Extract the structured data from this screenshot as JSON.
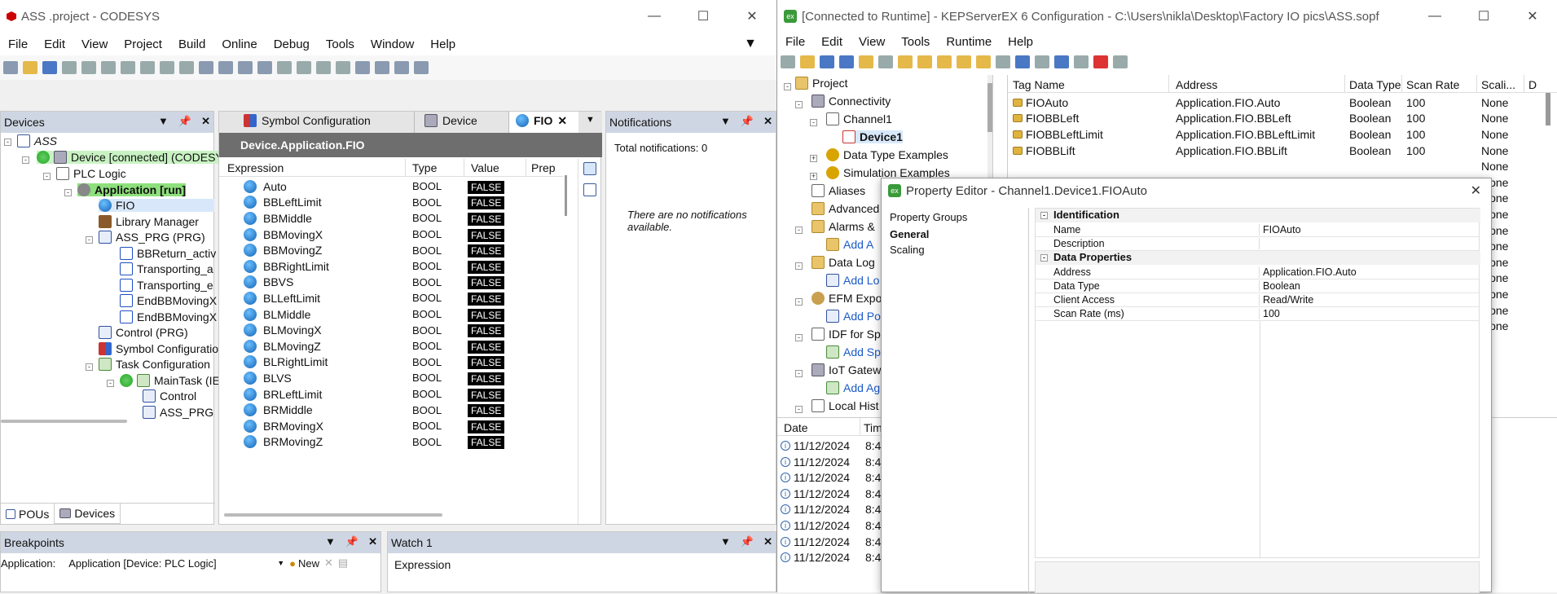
{
  "codesys": {
    "title": "ASS .project - CODESYS",
    "menu": [
      "File",
      "Edit",
      "View",
      "Project",
      "Build",
      "Online",
      "Debug",
      "Tools",
      "Window",
      "Help"
    ],
    "devices_panel": {
      "title": "Devices",
      "tree": [
        "ASS",
        "Device [connected] (CODESYS",
        "PLC Logic",
        "Application [run]",
        "FIO",
        "Library Manager",
        "ASS_PRG (PRG)",
        "BBReturn_activ",
        "Transporting_a",
        "Transporting_e",
        "EndBBMovingX",
        "EndBBMovingX",
        "Control (PRG)",
        "Symbol Configuratio",
        "Task Configuration",
        "MainTask (IE",
        "Control",
        "ASS_PRG"
      ]
    },
    "tabs": {
      "pous": "POUs",
      "devices": "Devices"
    },
    "editor_tabs": [
      "Symbol Configuration",
      "Device",
      "FIO"
    ],
    "watch_title": "Device.Application.FIO",
    "columns": {
      "expression": "Expression",
      "type": "Type",
      "value": "Value",
      "prep": "Prep"
    },
    "rows": [
      {
        "e": "Auto",
        "t": "BOOL",
        "v": "FALSE"
      },
      {
        "e": "BBLeftLimit",
        "t": "BOOL",
        "v": "FALSE"
      },
      {
        "e": "BBMiddle",
        "t": "BOOL",
        "v": "FALSE"
      },
      {
        "e": "BBMovingX",
        "t": "BOOL",
        "v": "FALSE"
      },
      {
        "e": "BBMovingZ",
        "t": "BOOL",
        "v": "FALSE"
      },
      {
        "e": "BBRightLimit",
        "t": "BOOL",
        "v": "FALSE"
      },
      {
        "e": "BBVS",
        "t": "BOOL",
        "v": "FALSE"
      },
      {
        "e": "BLLeftLimit",
        "t": "BOOL",
        "v": "FALSE"
      },
      {
        "e": "BLMiddle",
        "t": "BOOL",
        "v": "FALSE"
      },
      {
        "e": "BLMovingX",
        "t": "BOOL",
        "v": "FALSE"
      },
      {
        "e": "BLMovingZ",
        "t": "BOOL",
        "v": "FALSE"
      },
      {
        "e": "BLRightLimit",
        "t": "BOOL",
        "v": "FALSE"
      },
      {
        "e": "BLVS",
        "t": "BOOL",
        "v": "FALSE"
      },
      {
        "e": "BRLeftLimit",
        "t": "BOOL",
        "v": "FALSE"
      },
      {
        "e": "BRMiddle",
        "t": "BOOL",
        "v": "FALSE"
      },
      {
        "e": "BRMovingX",
        "t": "BOOL",
        "v": "FALSE"
      },
      {
        "e": "BRMovingZ",
        "t": "BOOL",
        "v": "FALSE"
      }
    ],
    "notifications": {
      "title": "Notifications",
      "total": "Total notifications: 0",
      "empty": "There are no notifications available."
    },
    "breakpoints": {
      "title": "Breakpoints",
      "app_label": "Application:",
      "app_value": "Application [Device: PLC Logic]",
      "new": "New"
    },
    "watch1": {
      "title": "Watch 1",
      "col": "Expression"
    }
  },
  "kep": {
    "title": "[Connected to Runtime] - KEPServerEX 6 Configuration - C:\\Users\\nikla\\Desktop\\Factory IO pics\\ASS.sopf",
    "menu": [
      "File",
      "Edit",
      "View",
      "Tools",
      "Runtime",
      "Help"
    ],
    "tree": [
      "Project",
      "Connectivity",
      "Channel1",
      "Device1",
      "Data Type Examples",
      "Simulation Examples",
      "Aliases",
      "Advanced",
      "Alarms &",
      "Add A",
      "Data Log",
      "Add Lo",
      "EFM Expo",
      "Add Po",
      "IDF for Sp",
      "Add Sp",
      "IoT Gatew",
      "Add Ag",
      "Local Hist"
    ],
    "columns": {
      "tag": "Tag Name",
      "address": "Address",
      "type": "Data Type",
      "scan": "Scan Rate",
      "scaling": "Scali...",
      "d": "D"
    },
    "tags": [
      {
        "n": "FIOAuto",
        "a": "Application.FIO.Auto",
        "t": "Boolean",
        "s": "100",
        "sc": "None"
      },
      {
        "n": "FIOBBLeft",
        "a": "Application.FIO.BBLeft",
        "t": "Boolean",
        "s": "100",
        "sc": "None"
      },
      {
        "n": "FIOBBLeftLimit",
        "a": "Application.FIO.BBLeftLimit",
        "t": "Boolean",
        "s": "100",
        "sc": "None"
      },
      {
        "n": "FIOBBLift",
        "a": "Application.FIO.BBLift",
        "t": "Boolean",
        "s": "100",
        "sc": "None"
      }
    ],
    "extra_scaling": [
      "None",
      "None",
      "None",
      "None",
      "None",
      "None",
      "None",
      "None",
      "None",
      "None",
      "None"
    ],
    "log": {
      "date": "Date",
      "time": "Tim",
      "rows": [
        "11/12/2024",
        "11/12/2024",
        "11/12/2024",
        "11/12/2024",
        "11/12/2024",
        "11/12/2024",
        "11/12/2024",
        "11/12/2024"
      ],
      "time_val": "8:4"
    },
    "prop": {
      "title": "Property Editor - Channel1.Device1.FIOAuto",
      "groups_title": "Property Groups",
      "groups": [
        "General",
        "Scaling"
      ],
      "sections": {
        "identification": "Identification",
        "data_props": "Data Properties"
      },
      "fields": [
        {
          "k": "Name",
          "v": "FIOAuto"
        },
        {
          "k": "Description",
          "v": ""
        },
        {
          "k": "Address",
          "v": "Application.FIO.Auto"
        },
        {
          "k": "Data Type",
          "v": "Boolean"
        },
        {
          "k": "Client Access",
          "v": "Read/Write"
        },
        {
          "k": "Scan Rate (ms)",
          "v": "100"
        }
      ]
    }
  }
}
